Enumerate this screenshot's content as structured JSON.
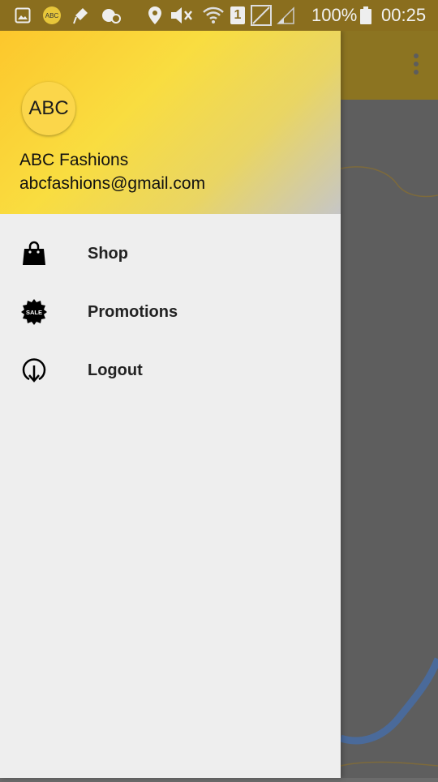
{
  "status_bar": {
    "battery_text": "100%",
    "time": "00:25",
    "sim_slot": "1",
    "notification_app_badge": "ABC",
    "icons": [
      "gallery-icon",
      "abc-app-icon",
      "mic-icon",
      "sync-icon",
      "location-icon",
      "mute-icon",
      "wifi-icon",
      "sim-icon",
      "no-signal-icon",
      "signal-icon",
      "battery-icon"
    ]
  },
  "drawer": {
    "header": {
      "avatar_text": "ABC",
      "name": "ABC Fashions",
      "email": "abcfashions@gmail.com"
    },
    "items": [
      {
        "label": "Shop",
        "icon": "shopping-bag-icon"
      },
      {
        "label": "Promotions",
        "icon": "sale-badge-icon",
        "icon_text": "SALE"
      },
      {
        "label": "Logout",
        "icon": "logout-icon"
      }
    ]
  },
  "colors": {
    "status_bar": "#8a6e1e",
    "app_bar": "#8c7421",
    "drawer_bg": "#eeeeee",
    "header_gradient_start": "#fcc72c",
    "header_gradient_end": "#c6c6c6",
    "route_line": "#4a6a9a"
  }
}
